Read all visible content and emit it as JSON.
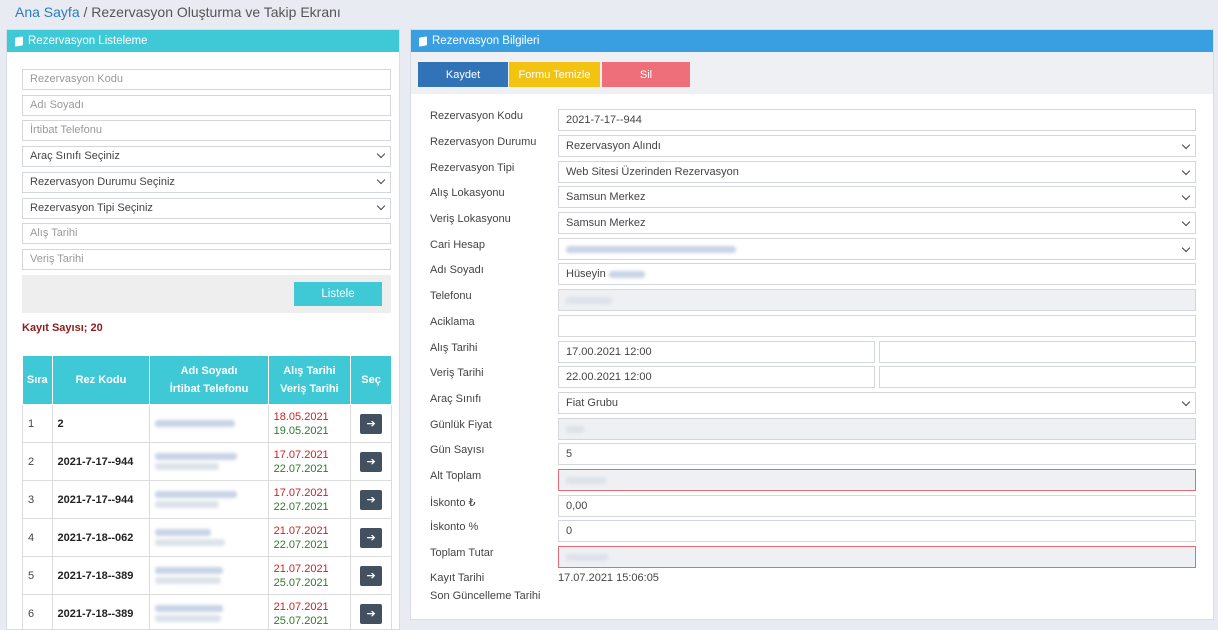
{
  "breadcrumb": {
    "home": "Ana Sayfa",
    "separator": " / ",
    "current": "Rezervasyon Oluşturma ve Takip Ekranı"
  },
  "left_panel": {
    "title": "Rezervasyon Listeleme",
    "filters": {
      "code_placeholder": "Rezervasyon Kodu",
      "name_placeholder": "Adı Soyadı",
      "phone_placeholder": "İrtibat Telefonu",
      "vehicle_class": "Araç Sınıfı Seçiniz",
      "status": "Rezervasyon Durumu Seçiniz",
      "type": "Rezervasyon Tipi Seçiniz",
      "pickup_date_placeholder": "Alış Tarihi",
      "return_date_placeholder": "Veriş Tarihi"
    },
    "list_button": "Listele",
    "count_label": "Kayıt Sayısı; 20",
    "table": {
      "headers": {
        "no": "Sıra",
        "code": "Rez Kodu",
        "name": "Adı Soyadı",
        "phone": "İrtibat Telefonu",
        "pickup": "Alış Tarihi",
        "return": "Veriş Tarihi",
        "select": "Seç"
      },
      "rows": [
        {
          "no": "1",
          "code": "2",
          "pickup": "18.05.2021",
          "return": "19.05.2021"
        },
        {
          "no": "2",
          "code": "2021-7-17--944",
          "pickup": "17.07.2021",
          "return": "22.07.2021"
        },
        {
          "no": "3",
          "code": "2021-7-17--944",
          "pickup": "17.07.2021",
          "return": "22.07.2021"
        },
        {
          "no": "4",
          "code": "2021-7-18--062",
          "pickup": "21.07.2021",
          "return": "22.07.2021"
        },
        {
          "no": "5",
          "code": "2021-7-18--389",
          "pickup": "21.07.2021",
          "return": "25.07.2021"
        },
        {
          "no": "6",
          "code": "2021-7-18--389",
          "pickup": "21.07.2021",
          "return": "25.07.2021"
        }
      ]
    }
  },
  "right_panel": {
    "title": "Rezervasyon Bilgileri",
    "buttons": {
      "save": "Kaydet",
      "clear": "Formu Temizle",
      "delete": "Sil"
    },
    "fields": {
      "code_label": "Rezervasyon Kodu",
      "code_value": "2021-7-17--944",
      "status_label": "Rezervasyon Durumu",
      "status_value": "Rezervasyon Alındı",
      "type_label": "Rezervasyon Tipi",
      "type_value": "Web Sitesi Üzerinden Rezervasyon",
      "pickup_loc_label": "Alış Lokasyonu",
      "pickup_loc_value": "Samsun Merkez",
      "return_loc_label": "Veriş Lokasyonu",
      "return_loc_value": "Samsun Merkez",
      "account_label": "Cari Hesap",
      "name_label": "Adı Soyadı",
      "name_value": "Hüseyin",
      "phone_label": "Telefonu",
      "desc_label": "Aciklama",
      "pickup_date_label": "Alış Tarihi",
      "pickup_date_value": "17.00.2021 12:00",
      "return_date_label": "Veriş Tarihi",
      "return_date_value": "22.00.2021 12:00",
      "vehicle_label": "Araç Sınıfı",
      "vehicle_value": "Fiat Grubu",
      "daily_price_label": "Günlük Fiyat",
      "days_label": "Gün Sayısı",
      "days_value": "5",
      "subtotal_label": "Alt Toplam",
      "discount_tl_label": "İskonto ₺",
      "discount_tl_value": "0,00",
      "discount_pct_label": "İskonto %",
      "discount_pct_value": "0",
      "total_label": "Toplam Tutar",
      "record_date_label": "Kayıt Tarihi",
      "record_date_value": "17.07.2021 15:06:05",
      "updated_label": "Son Güncelleme Tarihi"
    }
  }
}
